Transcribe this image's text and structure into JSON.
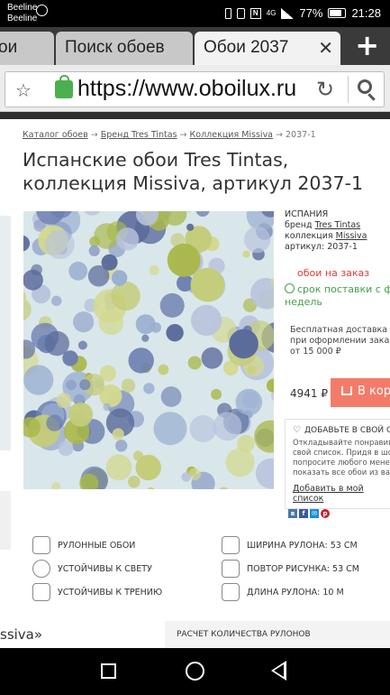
{
  "status_bar": {
    "carrier1": "Beeline",
    "carrier2": "Beeline",
    "network": "4G",
    "battery": "77%",
    "time": "21:28"
  },
  "tabs": [
    {
      "label": "ои"
    },
    {
      "label": "Поиск обоев"
    },
    {
      "label": "Обои 2037"
    }
  ],
  "url_bar": {
    "url": "https://www.oboilux.ru"
  },
  "breadcrumbs": {
    "item1": "Каталог обоев",
    "item2": "Бренд Tres Tintas",
    "item3": "Коллекция Missiva",
    "current": "2037-1"
  },
  "product": {
    "title": "Испанские обои Tres Tintas, коллекция Missiva, артикул 2037-1",
    "country": "ИСПАНИЯ",
    "brand_label": "бренд",
    "brand": "Tres Tintas",
    "collection_label": "коллекция",
    "collection": "Missiva",
    "article_label": "артикул:",
    "article": "2037-1",
    "order_status": "обои на заказ",
    "delivery_line1": "срок поставки с фабр",
    "delivery_line2": "недель",
    "free_shipping_line1": "Бесплатная доставка в пре",
    "free_shipping_line2": "при оформлении заказа",
    "free_shipping_line3": "от 15 000 ₽",
    "price": "4941 ₽",
    "cart_button": "В корз"
  },
  "wishlist": {
    "title": "ДОБАВЬТЕ В СВОЙ СПИС",
    "text_line1": "Откладывайте понравивши",
    "text_line2": "свой список. Придя в шоу-ру",
    "text_line3": "попросите любого менеджер",
    "text_line4": "показать все обои из вашего",
    "link": "Добавить в мой список"
  },
  "social_colors": {
    "vk": "#4a76a8",
    "fb": "#3b5998",
    "mail": "#168de2",
    "pinterest": "#cb2027"
  },
  "features": {
    "rolled": "РУЛОННЫЕ ОБОИ",
    "light": "УСТОЙЧИВЫ К СВЕТУ",
    "friction": "УСТОЙЧИВЫ К ТРЕНИЮ",
    "width": "ШИРИНА РУЛОНА: 53 СМ",
    "repeat": "ПОВТОР РИСУНКА: 53 СМ",
    "length": "ДЛИНА РУЛОНА: 10 М"
  },
  "bottom": {
    "left_text": "ssiva»",
    "calc_title": "РАСЧЕТ КОЛИЧЕСТВА РУЛОНОВ"
  },
  "colors": {
    "accent_button": "#f47b6a",
    "order_red": "#e53935",
    "delivery_green": "#43a047"
  }
}
